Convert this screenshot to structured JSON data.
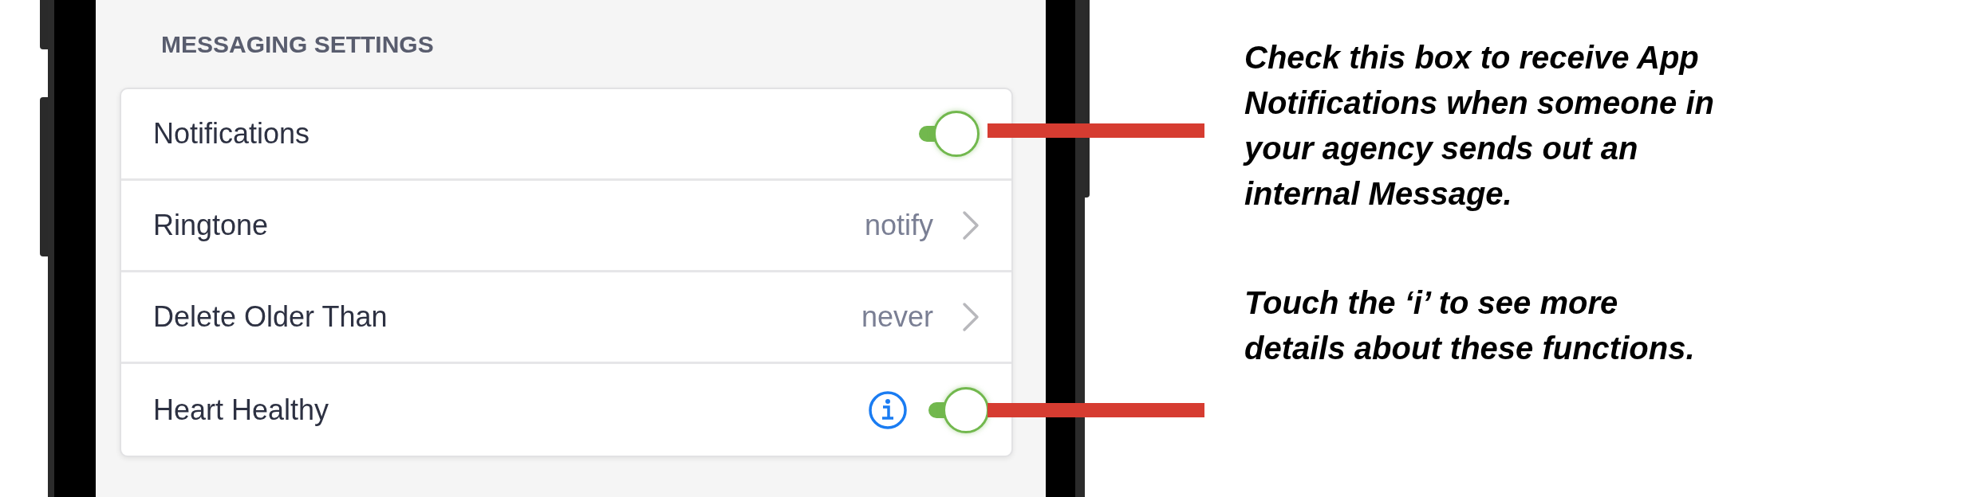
{
  "section_title": "MESSAGING SETTINGS",
  "settings": [
    {
      "kind": "toggle",
      "label": "Notifications",
      "on": true
    },
    {
      "kind": "link",
      "label": "Ringtone",
      "value": "notify"
    },
    {
      "kind": "link",
      "label": "Delete Older Than",
      "value": "never"
    },
    {
      "kind": "toggle_info",
      "label": "Heart Healthy",
      "on": true
    }
  ],
  "annotations": [
    "Check this box to receive App Notifications when someone in your agency sends out an internal Message.",
    "Touch the ‘i’ to see more details about these functions."
  ]
}
